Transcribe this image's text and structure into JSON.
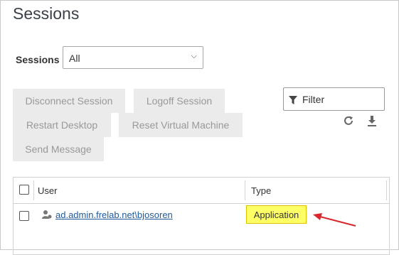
{
  "page": {
    "title": "Sessions"
  },
  "sessions_filter": {
    "label": "Sessions",
    "selected": "All"
  },
  "actions": {
    "disconnect": "Disconnect Session",
    "logoff": "Logoff Session",
    "restart": "Restart Desktop",
    "reset": "Reset Virtual Machine",
    "send_message": "Send Message"
  },
  "filter": {
    "label": "Filter"
  },
  "table": {
    "columns": [
      "User",
      "Type"
    ],
    "rows": [
      {
        "user": "ad.admin.frelab.net\\bjosoren",
        "type": "Application",
        "type_highlight_color": "#ffff66"
      }
    ]
  },
  "colors": {
    "link": "#1e5a9c",
    "annotation_arrow": "#d9272e"
  }
}
